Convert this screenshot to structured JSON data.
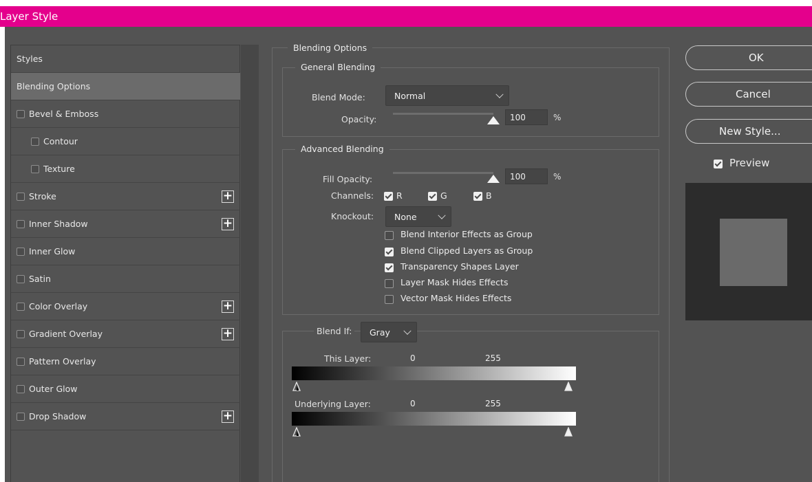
{
  "window": {
    "title": "Layer Style"
  },
  "sidebar": {
    "items": [
      {
        "label": "Styles",
        "checkbox": false,
        "plus": false,
        "selected": false,
        "indent": 0
      },
      {
        "label": "Blending Options",
        "checkbox": false,
        "plus": false,
        "selected": true,
        "indent": 0
      },
      {
        "label": "Bevel & Emboss",
        "checkbox": true,
        "checked": false,
        "plus": false,
        "selected": false,
        "indent": 0
      },
      {
        "label": "Contour",
        "checkbox": true,
        "checked": false,
        "plus": false,
        "selected": false,
        "indent": 1
      },
      {
        "label": "Texture",
        "checkbox": true,
        "checked": false,
        "plus": false,
        "selected": false,
        "indent": 1
      },
      {
        "label": "Stroke",
        "checkbox": true,
        "checked": false,
        "plus": true,
        "selected": false,
        "indent": 0
      },
      {
        "label": "Inner Shadow",
        "checkbox": true,
        "checked": false,
        "plus": true,
        "selected": false,
        "indent": 0
      },
      {
        "label": "Inner Glow",
        "checkbox": true,
        "checked": false,
        "plus": false,
        "selected": false,
        "indent": 0
      },
      {
        "label": "Satin",
        "checkbox": true,
        "checked": false,
        "plus": false,
        "selected": false,
        "indent": 0
      },
      {
        "label": "Color Overlay",
        "checkbox": true,
        "checked": false,
        "plus": true,
        "selected": false,
        "indent": 0
      },
      {
        "label": "Gradient Overlay",
        "checkbox": true,
        "checked": false,
        "plus": true,
        "selected": false,
        "indent": 0
      },
      {
        "label": "Pattern Overlay",
        "checkbox": true,
        "checked": false,
        "plus": false,
        "selected": false,
        "indent": 0
      },
      {
        "label": "Outer Glow",
        "checkbox": true,
        "checked": false,
        "plus": false,
        "selected": false,
        "indent": 0
      },
      {
        "label": "Drop Shadow",
        "checkbox": true,
        "checked": false,
        "plus": true,
        "selected": false,
        "indent": 0
      }
    ],
    "plus_symbol": "+"
  },
  "blending_options": {
    "title": "Blending Options",
    "general": {
      "title": "General Blending",
      "blend_mode_label": "Blend Mode:",
      "blend_mode_value": "Normal",
      "opacity_label": "Opacity:",
      "opacity_value": "100",
      "opacity_level": 1.0,
      "percent_sign": "%"
    },
    "advanced": {
      "title": "Advanced Blending",
      "fill_opacity_label": "Fill Opacity:",
      "fill_opacity_value": "100",
      "fill_opacity_level": 1.0,
      "percent_sign": "%",
      "channels_label": "Channels:",
      "channels": [
        {
          "label": "R",
          "checked": true
        },
        {
          "label": "G",
          "checked": true
        },
        {
          "label": "B",
          "checked": true
        }
      ],
      "knockout_label": "Knockout:",
      "knockout_value": "None",
      "options": [
        {
          "label": "Blend Interior Effects as Group",
          "checked": false
        },
        {
          "label": "Blend Clipped Layers as Group",
          "checked": true
        },
        {
          "label": "Transparency Shapes Layer",
          "checked": true
        },
        {
          "label": "Layer Mask Hides Effects",
          "checked": false
        },
        {
          "label": "Vector Mask Hides Effects",
          "checked": false
        }
      ]
    },
    "blend_if": {
      "label": "Blend If:",
      "value": "Gray",
      "this_layer_label": "This Layer:",
      "this_layer_min": "0",
      "this_layer_max": "255",
      "underlying_layer_label": "Underlying Layer:",
      "underlying_min": "0",
      "underlying_max": "255"
    }
  },
  "buttons": {
    "ok": "OK",
    "cancel": "Cancel",
    "new_style": "New Style...",
    "preview_label": "Preview",
    "preview_checked": true
  },
  "colors": {
    "title_bar": "#e4008c",
    "dialog_bg": "#535353",
    "selected_row": "#6b6b6b"
  }
}
